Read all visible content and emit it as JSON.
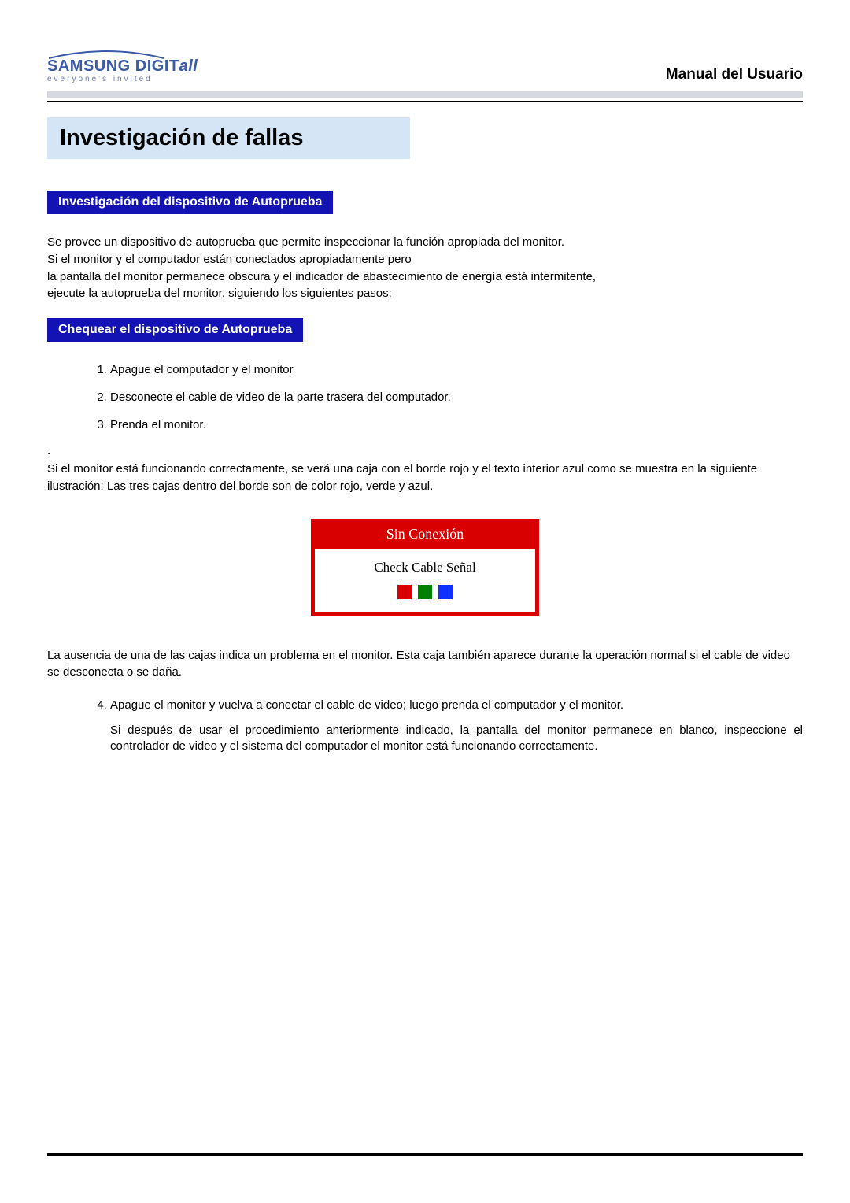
{
  "logo": {
    "brand_prefix": "SAMSUNG DIGIT",
    "brand_suffix": "all",
    "tagline": "everyone's invited"
  },
  "header": {
    "manual_title": "Manual del Usuario"
  },
  "title": "Investigación de fallas",
  "section1": {
    "heading": "Investigación del dispositivo de Autoprueba",
    "para": "Se provee un dispositivo de autoprueba que permite inspeccionar la función apropiada del monitor.\nSi el monitor y el computador están conectados apropiadamente pero\nla pantalla del monitor permanece obscura y el indicador de abastecimiento de energía está intermitente,\nejecute la autoprueba del monitor, siguiendo los siguientes pasos:"
  },
  "section2": {
    "heading": "Chequear el dispositivo de Autoprueba",
    "steps_1_3": [
      "Apague el computador y el monitor",
      "Desconecte el cable de video de la parte trasera del computador.",
      "Prenda el monitor."
    ],
    "dot": ".",
    "after_steps_para": "Si el monitor está funcionando correctamente, se verá una caja con el borde rojo y el texto interior azul como se muestra en la siguiente ilustración: Las tres cajas dentro del borde son de color rojo, verde y azul."
  },
  "illustration": {
    "head": "Sin Conexión",
    "body": "Check Cable Señal"
  },
  "after_illustration": "La ausencia de una de las cajas indica un problema en el monitor. Esta caja también aparece durante la operación normal si el cable de video se desconecta o se daña.",
  "step4": {
    "text": "Apague el monitor y vuelva a conectar el cable de video; luego prenda el computador y el monitor.",
    "sub": "Si después de usar el procedimiento anteriormente indicado, la pantalla del monitor permanece en blanco, inspeccione el controlador de video y el sistema del computador el monitor está funcionando correctamente."
  }
}
